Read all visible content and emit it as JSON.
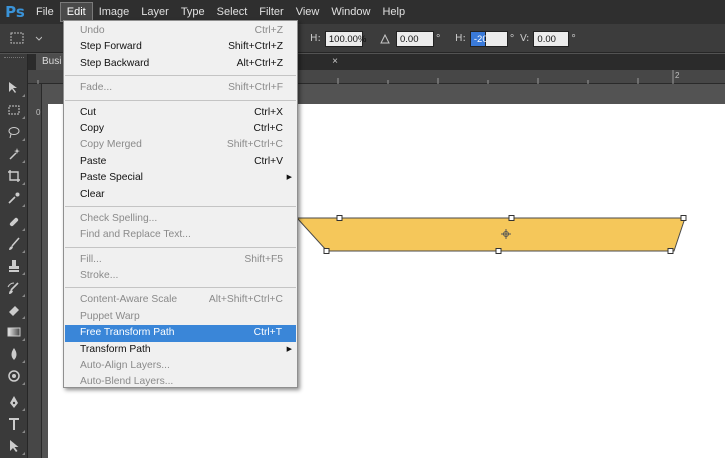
{
  "app": {
    "logo": "Ps"
  },
  "menubar": {
    "items": [
      "File",
      "Edit",
      "Image",
      "Layer",
      "Type",
      "Select",
      "Filter",
      "View",
      "Window",
      "Help"
    ],
    "active": "Edit"
  },
  "options": {
    "w_label": "H:",
    "w_value": "100.00%",
    "angle_value": "0.00",
    "h_label": "H:",
    "h_value": "-20",
    "v_label": "V:",
    "v_value": "0.00"
  },
  "tabs": {
    "doc_label": "Busi",
    "close": "×"
  },
  "ruler": {
    "top_mark": "2",
    "left_mark": "0"
  },
  "edit_menu": {
    "groups": [
      [
        {
          "label": "Undo",
          "shortcut": "Ctrl+Z",
          "disabled": true
        },
        {
          "label": "Step Forward",
          "shortcut": "Shift+Ctrl+Z"
        },
        {
          "label": "Step Backward",
          "shortcut": "Alt+Ctrl+Z"
        }
      ],
      [
        {
          "label": "Fade...",
          "shortcut": "Shift+Ctrl+F",
          "disabled": true
        }
      ],
      [
        {
          "label": "Cut",
          "shortcut": "Ctrl+X"
        },
        {
          "label": "Copy",
          "shortcut": "Ctrl+C"
        },
        {
          "label": "Copy Merged",
          "shortcut": "Shift+Ctrl+C",
          "disabled": true
        },
        {
          "label": "Paste",
          "shortcut": "Ctrl+V"
        },
        {
          "label": "Paste Special",
          "shortcut": "",
          "submenu": true
        },
        {
          "label": "Clear",
          "shortcut": ""
        }
      ],
      [
        {
          "label": "Check Spelling...",
          "shortcut": "",
          "disabled": true
        },
        {
          "label": "Find and Replace Text...",
          "shortcut": "",
          "disabled": true
        }
      ],
      [
        {
          "label": "Fill...",
          "shortcut": "Shift+F5",
          "disabled": true
        },
        {
          "label": "Stroke...",
          "shortcut": "",
          "disabled": true
        }
      ],
      [
        {
          "label": "Content-Aware Scale",
          "shortcut": "Alt+Shift+Ctrl+C",
          "disabled": true
        },
        {
          "label": "Puppet Warp",
          "shortcut": "",
          "disabled": true
        },
        {
          "label": "Free Transform Path",
          "shortcut": "Ctrl+T",
          "highlight": true
        },
        {
          "label": "Transform Path",
          "shortcut": "",
          "submenu": true
        },
        {
          "label": "Auto-Align Layers...",
          "shortcut": "",
          "disabled": true
        },
        {
          "label": "Auto-Blend Layers...",
          "shortcut": "",
          "disabled": true
        }
      ]
    ]
  },
  "tools": [
    "move-icon",
    "marquee-icon",
    "lasso-icon",
    "magic-wand-icon",
    "crop-icon",
    "eyedropper-icon",
    "healing-brush-icon",
    "brush-icon",
    "clone-stamp-icon",
    "history-brush-icon",
    "eraser-icon",
    "gradient-icon",
    "blur-icon",
    "dodge-icon",
    "pen-icon",
    "type-icon",
    "path-selection-icon"
  ],
  "shape": {
    "fill": "#f5c75a",
    "stroke": "#4a4a4a"
  }
}
